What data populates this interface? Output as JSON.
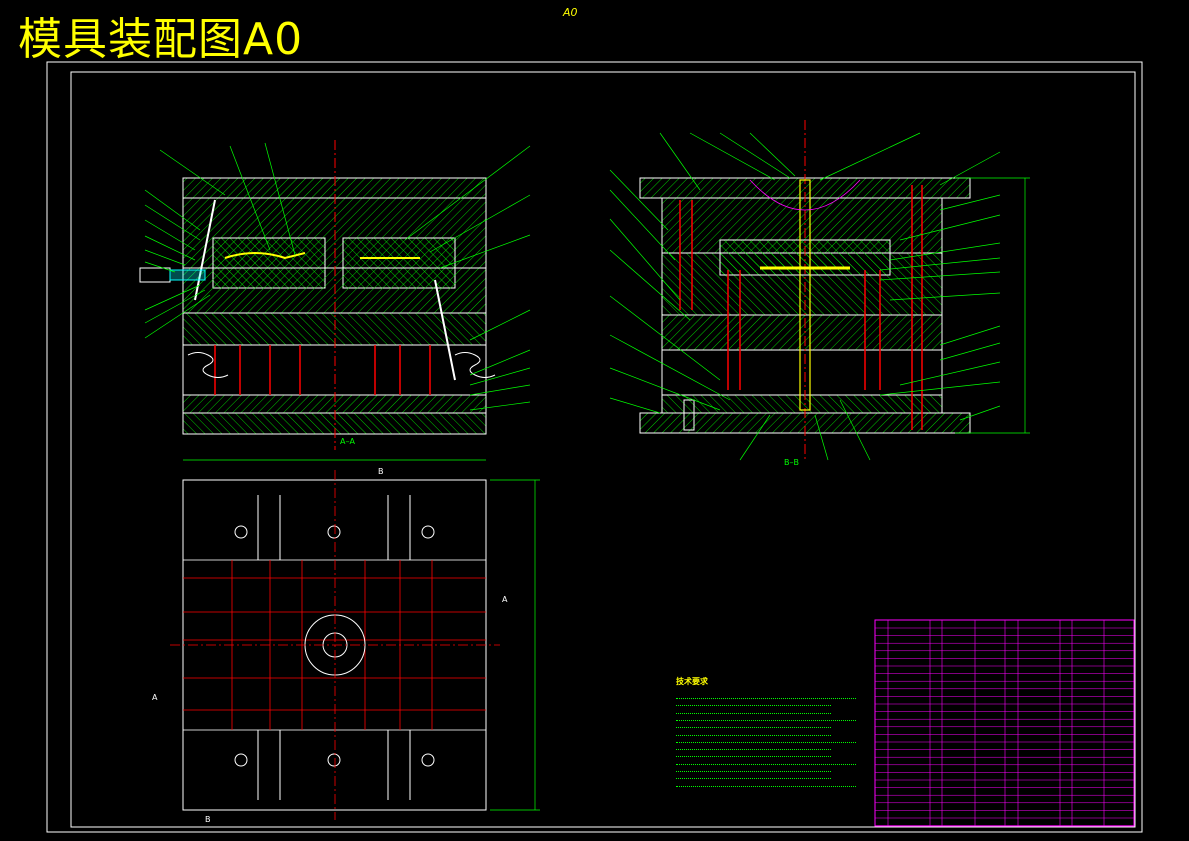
{
  "title": "模具装配图A0",
  "sheet_label": "A0",
  "views": {
    "section_aa_label": "A–A",
    "section_bb_label": "B–B",
    "plan_marks": [
      "B",
      "A",
      "B",
      "A"
    ]
  },
  "tech_requirements": {
    "title": "技术要求",
    "line_count_note": ""
  },
  "title_block": {
    "name": ""
  },
  "colors": {
    "frame": "#ffffff",
    "hatch": "#00ff00",
    "outline": "#ffffff",
    "centerline": "#ff0000",
    "dimension": "#00ff00",
    "bom_grid": "#ff00ff",
    "highlight": "#ffff00"
  }
}
